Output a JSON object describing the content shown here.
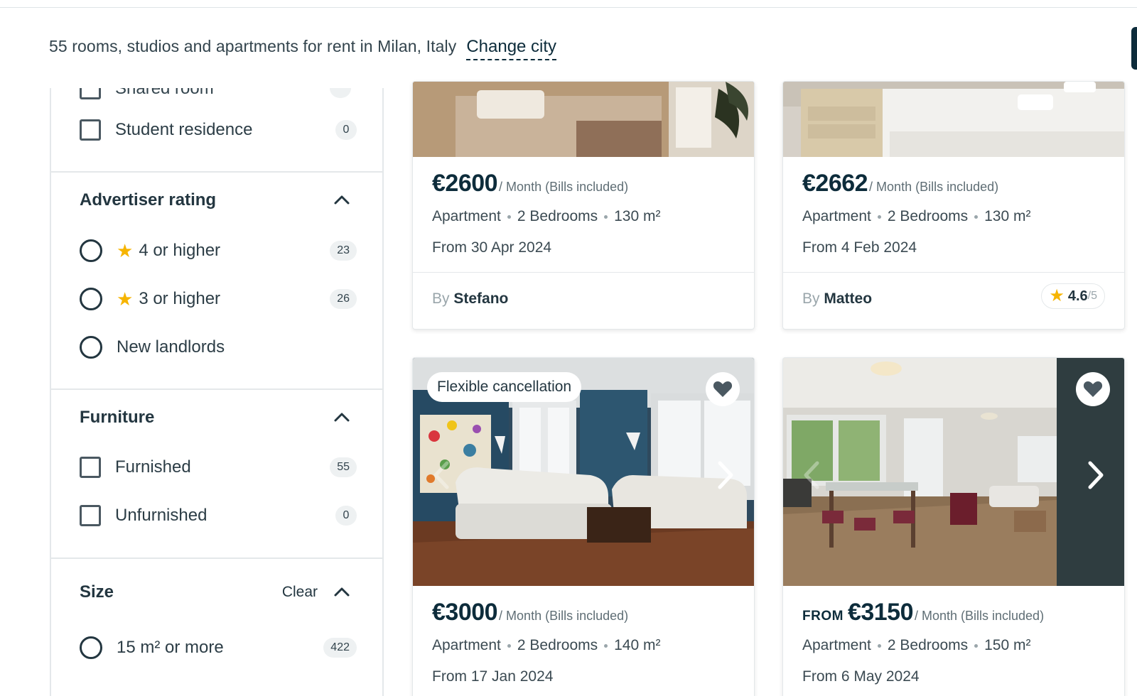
{
  "header": {
    "title": "55 rooms, studios and apartments for rent in Milan, Italy",
    "change_city": "Change city"
  },
  "sidebar": {
    "partial_item": {
      "label": "Shared room"
    },
    "student_residence": {
      "label": "Student residence",
      "count": "0"
    },
    "advertiser_rating": {
      "title": "Advertiser rating",
      "options": [
        {
          "label": "4 or higher",
          "count": "23"
        },
        {
          "label": "3 or higher",
          "count": "26"
        },
        {
          "label": "New landlords"
        }
      ]
    },
    "furniture": {
      "title": "Furniture",
      "options": [
        {
          "label": "Furnished",
          "count": "55"
        },
        {
          "label": "Unfurnished",
          "count": "0"
        }
      ]
    },
    "size": {
      "title": "Size",
      "clear": "Clear",
      "options": [
        {
          "label": "15 m² or more",
          "count": "422"
        }
      ]
    }
  },
  "listings": [
    {
      "price": "€2600",
      "period": "/ Month (Bills included)",
      "type": "Apartment",
      "bedrooms": "2 Bedrooms",
      "size": "130 m²",
      "available": "From 30 Apr 2024",
      "by_prefix": "By",
      "landlord": "Stefano"
    },
    {
      "price": "€2662",
      "period": "/ Month (Bills included)",
      "type": "Apartment",
      "bedrooms": "2 Bedrooms",
      "size": "130 m²",
      "available": "From 4 Feb 2024",
      "by_prefix": "By",
      "landlord": "Matteo",
      "rating": "4.6",
      "rating_den": "/5"
    },
    {
      "badge": "Flexible cancellation",
      "price": "€3000",
      "period": "/ Month (Bills included)",
      "type": "Apartment",
      "bedrooms": "2 Bedrooms",
      "size": "140 m²",
      "available": "From 17 Jan 2024"
    },
    {
      "price_prefix": "FROM",
      "price": "€3150",
      "period": "/ Month (Bills included)",
      "type": "Apartment",
      "bedrooms": "2 Bedrooms",
      "size": "150 m²",
      "available": "From 6 May 2024"
    }
  ],
  "colors": {
    "primary": "#0d2c3b",
    "star": "#f6b400",
    "border": "#e4e8ea"
  },
  "icons": [
    "star-icon",
    "chevron-up-icon",
    "heart-icon",
    "chevron-right-icon",
    "chevron-left-icon"
  ]
}
